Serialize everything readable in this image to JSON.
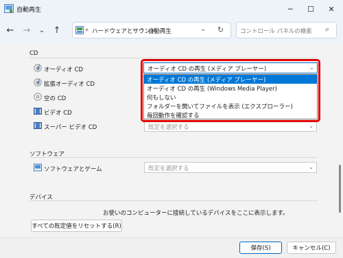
{
  "window": {
    "title": "自動再生"
  },
  "titlebar": {
    "minimize": "─",
    "maximize": "☐",
    "close": "✕"
  },
  "nav": {
    "back": "←",
    "forward": "→",
    "recent": "⌄",
    "up": "↑",
    "breadcrumb_overflow": "«",
    "breadcrumb_parent": "ハードウェアとサウンド",
    "breadcrumb_sep": "›",
    "breadcrumb_current": "自動再生",
    "address_dropdown": "⌄",
    "refresh": "↻",
    "search_placeholder": "コントロール パネルの検索",
    "search_icon": "⌕"
  },
  "cd_section": {
    "title": "CD",
    "rows": [
      {
        "label": "オーディオ CD",
        "icon": "audio-cd-icon"
      },
      {
        "label": "拡張オーディオ CD",
        "icon": "enhanced-audio-cd-icon"
      },
      {
        "label": "空の CD",
        "icon": "blank-cd-icon"
      },
      {
        "label": "ビデオ CD",
        "icon": "video-cd-icon"
      },
      {
        "label": "スーパー ビデオ CD",
        "icon": "super-video-cd-icon"
      }
    ],
    "default_select": "既定を選択する"
  },
  "dropdown": {
    "selected": "オーディオ CD の再生 (メディア プレーヤー)",
    "options": [
      "オーディオ CD の再生 (メディア プレーヤー)",
      "オーディオ CD の再生 (Windows Media Player)",
      "何もしない",
      "フォルダーを開いてファイルを表示 (エクスプローラー)",
      "毎回動作を確認する"
    ],
    "highlighted_index": 0
  },
  "software_section": {
    "title": "ソフトウェア",
    "row_label": "ソフトウェアとゲーム",
    "select": "既定を選択する"
  },
  "devices_section": {
    "title": "デバイス",
    "message": "お使いのコンピューターに接続しているデバイスをここに表示します。"
  },
  "reset_button": "すべての既定値をリセットする(R)",
  "footer": {
    "save": "保存(S)",
    "cancel": "キャンセル(C)"
  },
  "colors": {
    "accent": "#0078d7",
    "highlight_frame": "#e00000"
  }
}
